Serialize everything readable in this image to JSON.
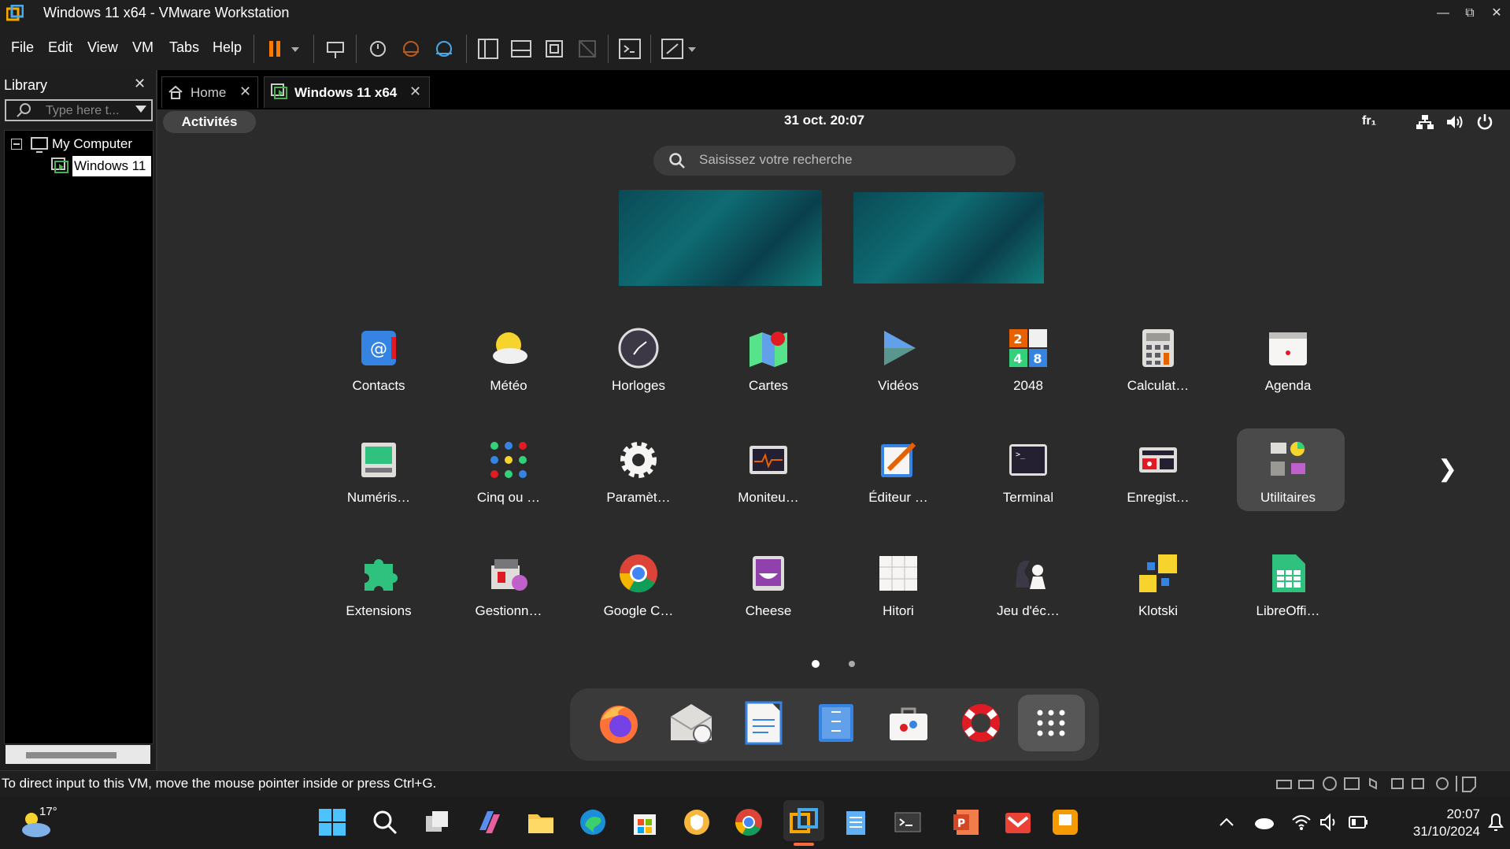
{
  "window": {
    "title": "Windows 11 x64 - VMware Workstation"
  },
  "menu": [
    "File",
    "Edit",
    "View",
    "VM",
    "Tabs",
    "Help"
  ],
  "library": {
    "title": "Library",
    "search_placeholder": "Type here t...",
    "tree": {
      "root": "My Computer",
      "child": "Windows 11"
    }
  },
  "tabs": [
    {
      "label": "Home"
    },
    {
      "label": "Windows 11 x64"
    }
  ],
  "gnome": {
    "activities": "Activités",
    "clock": "31 oct.  20:07",
    "keyboard": "fr₁",
    "search_placeholder": "Saisissez votre recherche",
    "apps_row1": [
      "Contacts",
      "Météo",
      "Horloges",
      "Cartes",
      "Vidéos",
      "2048",
      "Calculat…",
      "Agenda"
    ],
    "apps_row2": [
      "Numéris…",
      "Cinq ou …",
      "Paramèt…",
      "Moniteu…",
      "Éditeur …",
      "Terminal",
      "Enregist…",
      "Utilitaires"
    ],
    "apps_row3": [
      "Extensions",
      "Gestionn…",
      "Google C…",
      "Cheese",
      "Hitori",
      "Jeu d'éc…",
      "Klotski",
      "LibreOffi…"
    ],
    "page_count": 2,
    "current_page": 1
  },
  "status": {
    "message": "To direct input to this VM, move the mouse pointer inside or press Ctrl+G."
  },
  "taskbar": {
    "weather": "17°",
    "time": "20:07",
    "date": "31/10/2024"
  },
  "colors": {
    "accent": "#ff8a00",
    "gnome_bg": "#2b2b2b"
  }
}
